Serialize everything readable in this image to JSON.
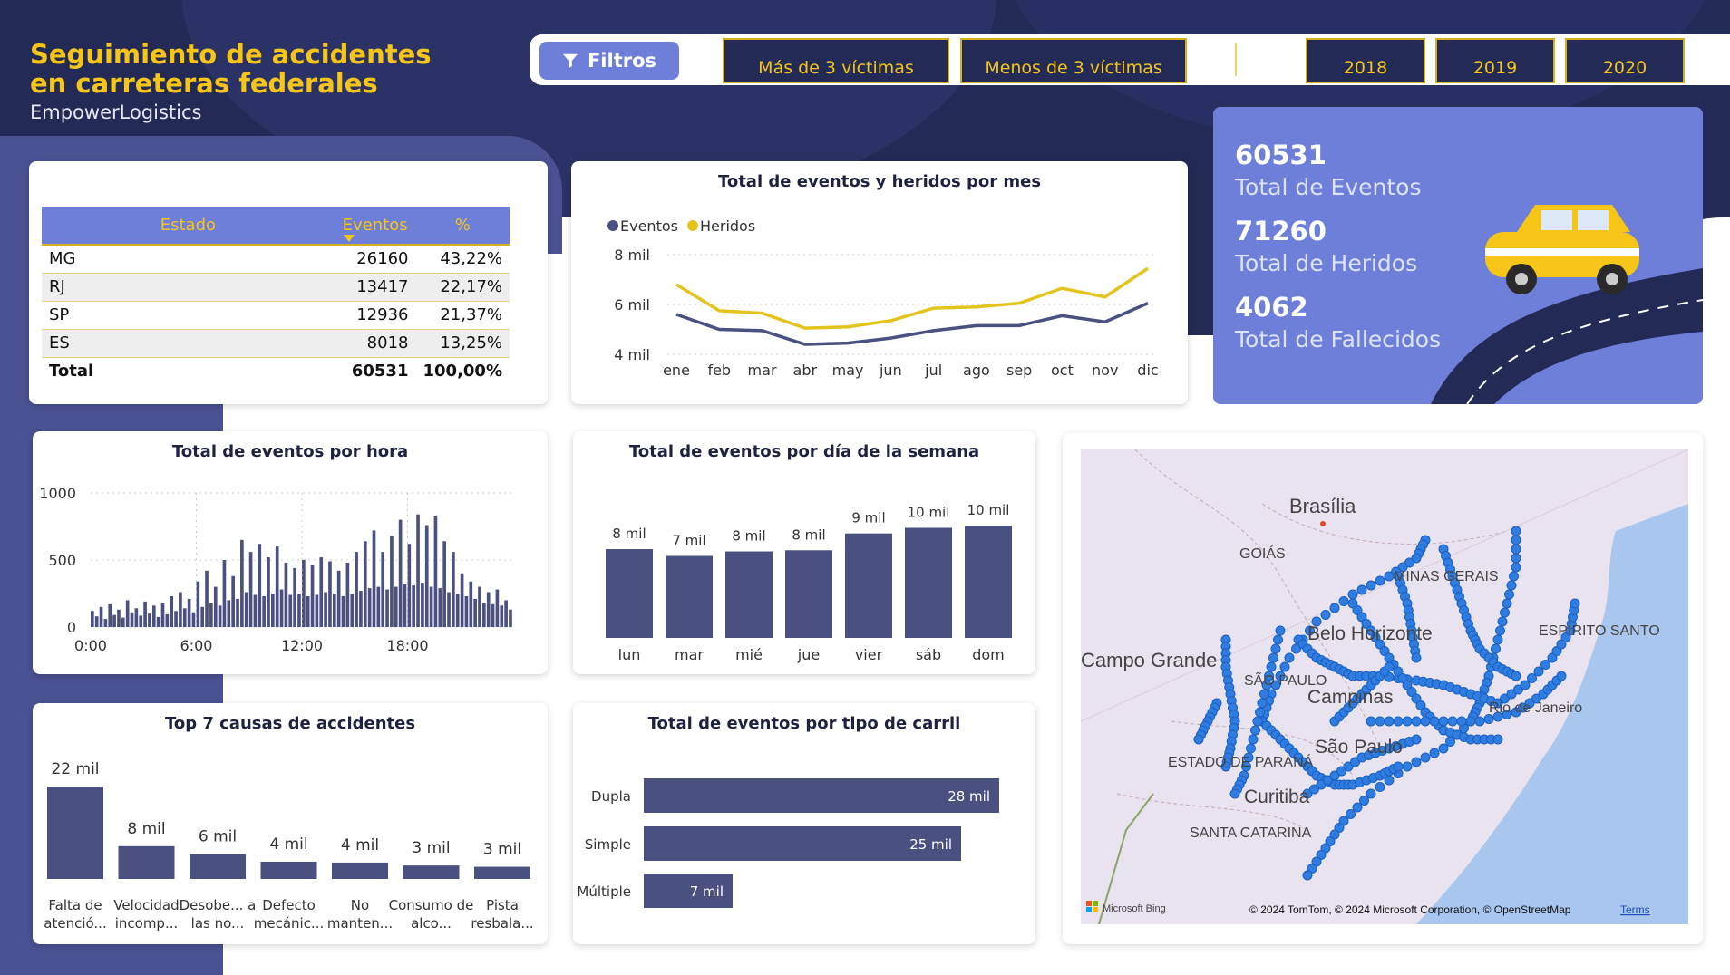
{
  "header": {
    "title_line1": "Seguimiento de accidentes",
    "title_line2": "en carreteras federales",
    "company": "EmpowerLogistics"
  },
  "filters": {
    "button_label": "Filtros",
    "victims": [
      "Más de 3 víctimas",
      "Menos de 3 víctimas"
    ],
    "years": [
      "2018",
      "2019",
      "2020"
    ]
  },
  "estado_table": {
    "headers": [
      "Estado",
      "Eventos",
      "%"
    ],
    "rows": [
      {
        "estado": "MG",
        "eventos": "26160",
        "pct": "43,22%"
      },
      {
        "estado": "RJ",
        "eventos": "13417",
        "pct": "22,17%"
      },
      {
        "estado": "SP",
        "eventos": "12936",
        "pct": "21,37%"
      },
      {
        "estado": "ES",
        "eventos": "8018",
        "pct": "13,25%"
      }
    ],
    "total": {
      "label": "Total",
      "eventos": "60531",
      "pct": "100,00%"
    }
  },
  "kpis": {
    "eventos_value": "60531",
    "eventos_label": "Total de Eventos",
    "heridos_value": "71260",
    "heridos_label": "Total de Heridos",
    "fallecidos_value": "4062",
    "fallecidos_label": "Total de Fallecidos"
  },
  "colors": {
    "navy": "#232a55",
    "accent": "#6d7fd9",
    "yellow": "#f5c518",
    "bar": "#4a5080"
  },
  "chart_data": [
    {
      "type": "line",
      "title": "Total de eventos y heridos por mes",
      "categories": [
        "ene",
        "feb",
        "mar",
        "abr",
        "may",
        "jun",
        "jul",
        "ago",
        "sep",
        "oct",
        "nov",
        "dic"
      ],
      "yticks": [
        "8 mil",
        "6 mil",
        "4 mil"
      ],
      "ylim": [
        4000,
        8000
      ],
      "legend": "top-left",
      "series": [
        {
          "name": "Eventos",
          "color": "#4a5080",
          "values": [
            5600,
            5000,
            4950,
            4400,
            4450,
            4650,
            4950,
            5150,
            5150,
            5550,
            5300,
            6050
          ]
        },
        {
          "name": "Heridos",
          "color": "#e3c41e",
          "values": [
            6800,
            5750,
            5650,
            5050,
            5100,
            5350,
            5850,
            5900,
            6050,
            6650,
            6300,
            7450
          ]
        }
      ]
    },
    {
      "type": "bar",
      "title": "Total de eventos por hora",
      "xticks": [
        "0:00",
        "6:00",
        "12:00",
        "18:00"
      ],
      "yticks": [
        "1000",
        "500",
        "0"
      ],
      "ylim": [
        0,
        1000
      ],
      "values": [
        120,
        80,
        150,
        60,
        170,
        90,
        130,
        70,
        200,
        110,
        140,
        85,
        190,
        100,
        160,
        75,
        180,
        95,
        230,
        120,
        260,
        140,
        210,
        110,
        340,
        150,
        420,
        180,
        300,
        160,
        500,
        200,
        380,
        210,
        650,
        260,
        560,
        240,
        620,
        230,
        520,
        250,
        600,
        280,
        480,
        240,
        440,
        250,
        500,
        230,
        460,
        240,
        520,
        260,
        490,
        250,
        420,
        230,
        480,
        250,
        560,
        270,
        640,
        290,
        720,
        300,
        560,
        280,
        680,
        300,
        800,
        320,
        620,
        310,
        840,
        330,
        760,
        300,
        830,
        290,
        640,
        260,
        560,
        250,
        400,
        230,
        340,
        210,
        300,
        180,
        260,
        170,
        280,
        160,
        200,
        130
      ]
    },
    {
      "type": "bar",
      "title": "Total de eventos por día de la semana",
      "categories": [
        "lun",
        "mar",
        "mié",
        "jue",
        "vier",
        "sáb",
        "dom"
      ],
      "labels": [
        "8 mil",
        "7 mil",
        "8 mil",
        "8 mil",
        "9 mil",
        "10 mil",
        "10 mil"
      ],
      "values": [
        7900,
        7300,
        7700,
        7800,
        9300,
        9800,
        10000
      ]
    },
    {
      "type": "bar",
      "title": "Top 7 causas de accidentes",
      "categories": [
        "Falta de atenció...",
        "Velocidad incomp...",
        "Desobe... a las no...",
        "Defecto mecánic...",
        "No manten...",
        "Consumo de alco...",
        "Pista resbala..."
      ],
      "labels": [
        "22 mil",
        "8 mil",
        "6 mil",
        "4 mil",
        "4 mil",
        "3 mil",
        "3 mil"
      ],
      "values": [
        22000,
        7800,
        5900,
        4100,
        3900,
        3200,
        2900
      ]
    },
    {
      "type": "bar",
      "title": "Total de eventos por tipo de carril",
      "categories": [
        "Dupla",
        "Simple",
        "Múltiple"
      ],
      "labels": [
        "28 mil",
        "25 mil",
        "7 mil"
      ],
      "values": [
        28000,
        25000,
        7000
      ]
    }
  ],
  "map": {
    "labels": [
      "Brasília",
      "GOIÁS",
      "MINAS GERAIS",
      "Belo Horizonte",
      "ESPÍRITO SANTO",
      "Campo Grande",
      "SÃO PAULO",
      "Campinas",
      "Rio de Janeiro",
      "São Paulo",
      "ESTADO DE PARANÁ",
      "Curitiba",
      "SANTA CATARINA"
    ],
    "attribution": "© 2024 TomTom, © 2024 Microsoft Corporation, © OpenStreetMap",
    "terms": "Terms",
    "bing": "Microsoft Bing"
  }
}
